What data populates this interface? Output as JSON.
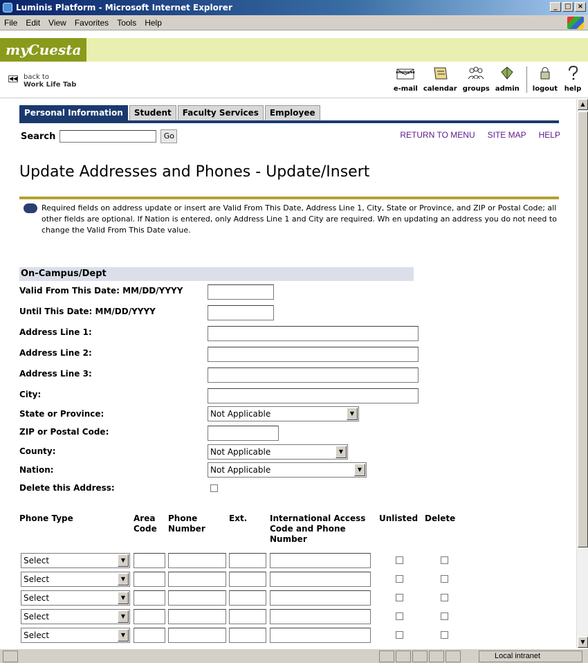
{
  "window": {
    "title": "Luminis Platform - Microsoft Internet Explorer"
  },
  "menu": [
    "File",
    "Edit",
    "View",
    "Favorites",
    "Tools",
    "Help"
  ],
  "brand": {
    "logo": "myCuesta"
  },
  "back": {
    "line1": "back to",
    "line2": "Work Life Tab"
  },
  "tools": [
    {
      "label": "e-mail",
      "icon": "employee-email-icon",
      "sublabel": "employee"
    },
    {
      "label": "calendar",
      "icon": "calendar-icon"
    },
    {
      "label": "groups",
      "icon": "groups-icon"
    },
    {
      "label": "admin",
      "icon": "admin-icon"
    },
    {
      "label": "logout",
      "icon": "logout-icon"
    },
    {
      "label": "help",
      "icon": "help-icon"
    }
  ],
  "tabs": [
    "Personal Information",
    "Student",
    "Faculty Services",
    "Employee"
  ],
  "search": {
    "label": "Search",
    "button": "Go"
  },
  "links": [
    "RETURN TO MENU",
    "SITE MAP",
    "HELP"
  ],
  "page": {
    "title": "Update Addresses and Phones - Update/Insert",
    "info": "Required fields on address update or insert are Valid From This Date, Address Line 1, City, State or Province, and ZIP or Postal Code; all other fields are optional. If Nation is entered, only Address Line 1 and City are required. Wh en updating an address you do not need to change the Valid From This Date value."
  },
  "section": "On-Campus/Dept",
  "fields": {
    "valid_from": "Valid From This Date: MM/DD/YYYY",
    "until": "Until This Date: MM/DD/YYYY",
    "addr1": "Address Line 1:",
    "addr2": "Address Line 2:",
    "addr3": "Address Line 3:",
    "city": "City:",
    "state": "State or Province:",
    "zip": "ZIP or Postal Code:",
    "county": "County:",
    "nation": "Nation:",
    "delete": "Delete this Address:"
  },
  "selects": {
    "state": "Not Applicable",
    "county": "Not Applicable",
    "nation": "Not Applicable"
  },
  "phone_headers": {
    "type": "Phone Type",
    "area": "Area Code",
    "number": "Phone Number",
    "ext": "Ext.",
    "intl": "International Access Code and Phone Number",
    "unlisted": "Unlisted",
    "delete": "Delete"
  },
  "phone_rows": [
    {
      "type": "Select"
    },
    {
      "type": "Select"
    },
    {
      "type": "Select"
    },
    {
      "type": "Select"
    },
    {
      "type": "Select"
    }
  ],
  "status": {
    "zone": "Local intranet"
  }
}
